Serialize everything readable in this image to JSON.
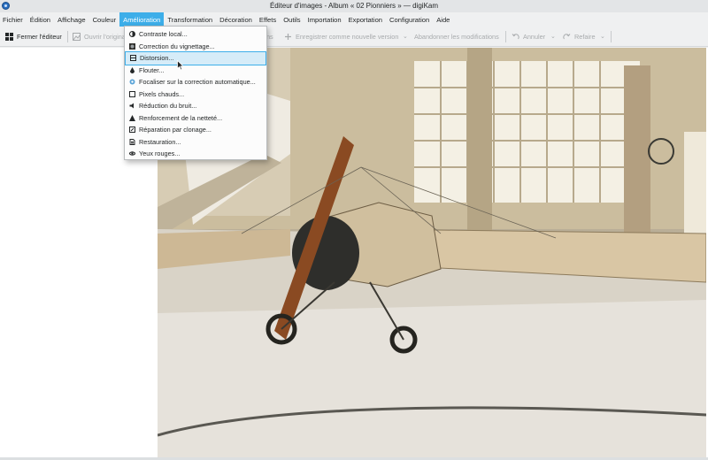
{
  "window": {
    "title": "Éditeur d'images - Album « 02 Pionniers » — digiKam"
  },
  "menubar": {
    "items": [
      {
        "label": "Fichier"
      },
      {
        "label": "Édition"
      },
      {
        "label": "Affichage"
      },
      {
        "label": "Couleur"
      },
      {
        "label": "Amélioration",
        "active": true
      },
      {
        "label": "Transformation"
      },
      {
        "label": "Décoration"
      },
      {
        "label": "Effets"
      },
      {
        "label": "Outils"
      },
      {
        "label": "Importation"
      },
      {
        "label": "Exportation"
      },
      {
        "label": "Configuration"
      },
      {
        "label": "Aide"
      }
    ]
  },
  "toolbar": {
    "close_editor": "Fermer l'éditeur",
    "open_original": "Ouvrir l'original",
    "save_fragment": "ns",
    "save_as_new_version": "Enregistrer comme nouvelle version",
    "discard_changes": "Abandonner les modifications",
    "undo": "Annuler",
    "redo": "Refaire"
  },
  "enhance_menu": {
    "items": [
      {
        "label": "Contraste local...",
        "icon": "contrast-icon"
      },
      {
        "label": "Correction du vignettage...",
        "icon": "vignette-icon"
      },
      {
        "label": "Distorsion...",
        "icon": "distortion-icon",
        "highlighted": true
      },
      {
        "label": "Flouter...",
        "icon": "blur-drop-icon"
      },
      {
        "label": "Focaliser sur la correction automatique...",
        "icon": "autofocus-icon"
      },
      {
        "label": "Pixels chauds...",
        "icon": "hot-pixels-icon"
      },
      {
        "label": "Réduction du bruit...",
        "icon": "noise-reduction-icon"
      },
      {
        "label": "Renforcement de la netteté...",
        "icon": "sharpen-icon"
      },
      {
        "label": "Réparation par clonage...",
        "icon": "clone-repair-icon"
      },
      {
        "label": "Restauration...",
        "icon": "restoration-icon"
      },
      {
        "label": "Yeux rouges...",
        "icon": "red-eye-icon"
      }
    ]
  },
  "colors": {
    "accent": "#3daee9",
    "highlight_bg": "#d6ecf8",
    "menubar_bg": "#eff0f1"
  }
}
